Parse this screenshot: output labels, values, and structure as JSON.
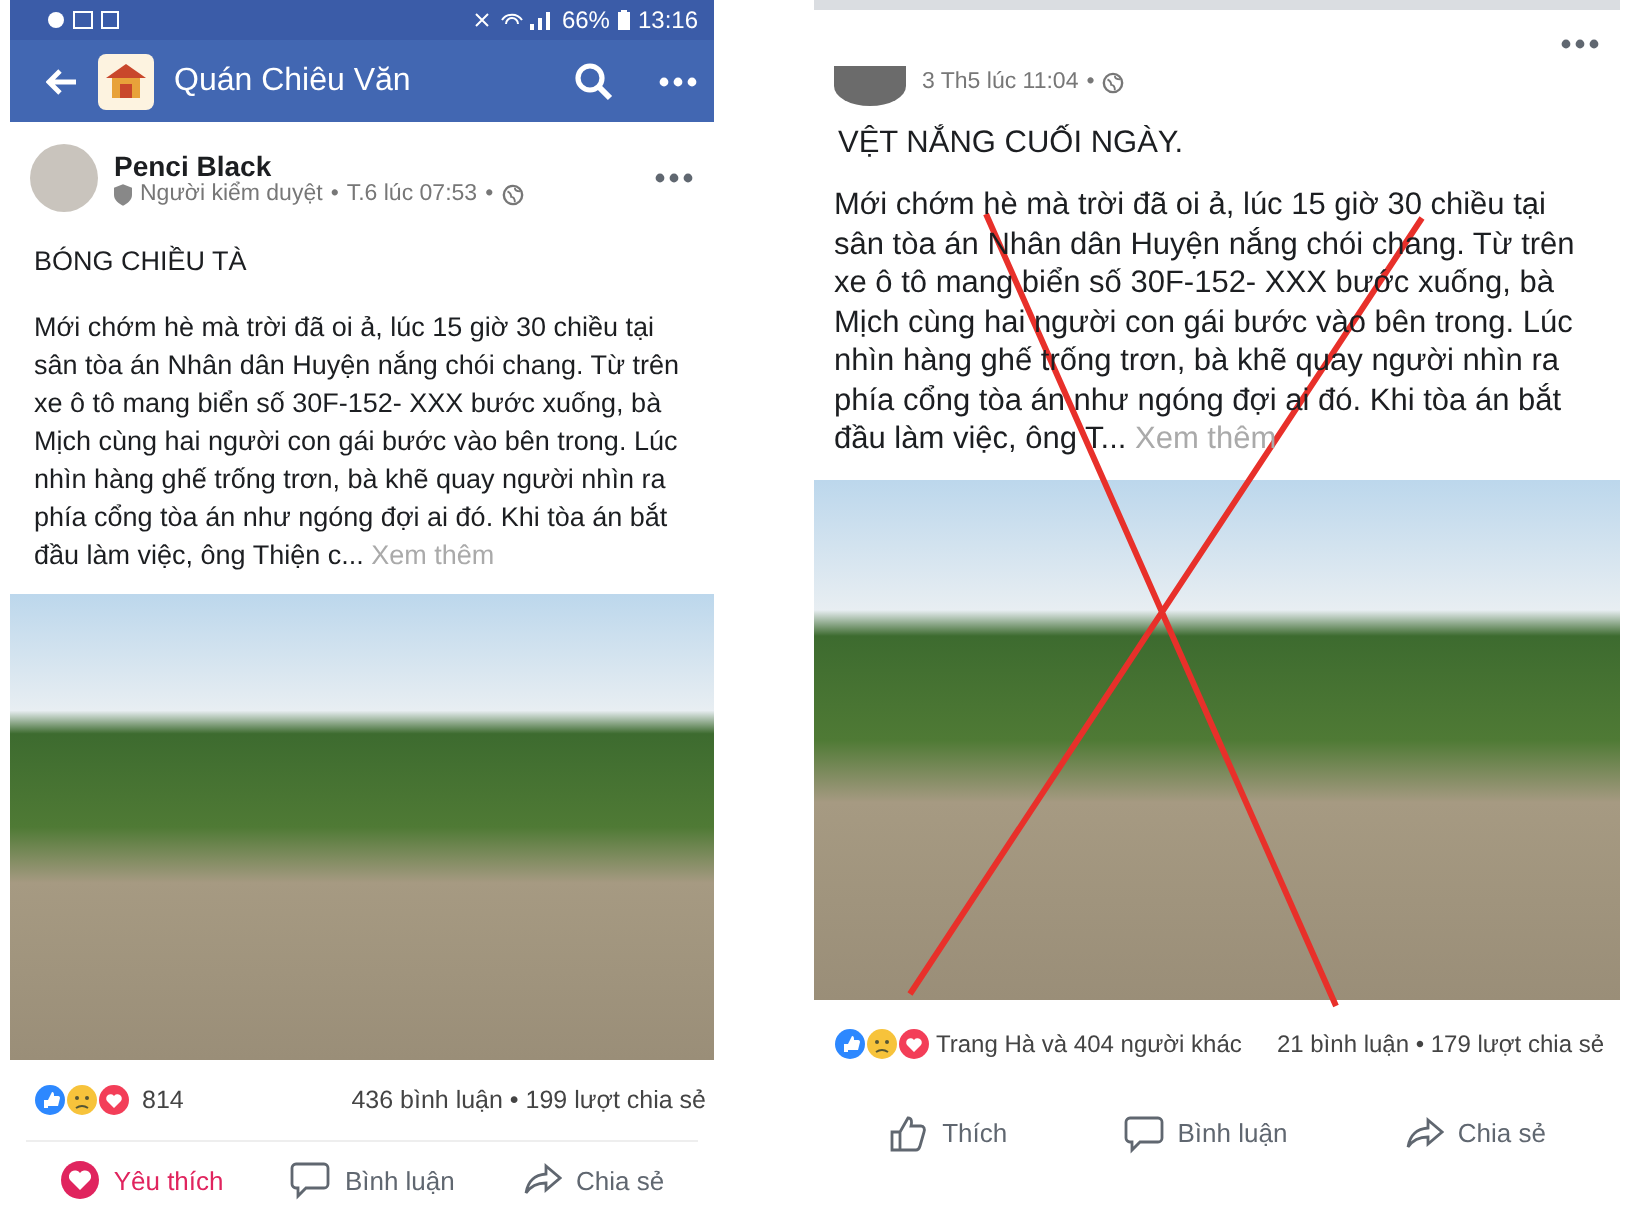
{
  "screens": [
    {
      "separator": "•",
      "status_bar": {
        "battery": "66%",
        "time": "13:16"
      },
      "app_bar": {
        "title": "Quán Chiêu Văn"
      },
      "post": {
        "author": "Penci Black",
        "role": "Người kiểm duyệt",
        "time": "T.6 lúc 07:53",
        "title": "BÓNG CHIỀU TÀ",
        "body": "Mới chớm hè mà trời đã oi ả, lúc 15 giờ 30 chiều tại sân tòa án Nhân dân Huyện nắng chói chang. Từ trên xe ô tô mang biển số 30F-152- XXX bước xuống, bà Mịch cùng hai người con gái bước vào bên trong. Lúc nhìn hàng ghế trống trơn, bà khẽ quay người nhìn ra phía cổng tòa án như ngóng đợi ai đó. Khi tòa án bắt đầu làm việc, ông Thiện c...",
        "see_more": "Xem thêm",
        "crossed_out": false,
        "reactions": "814",
        "stats": "436 bình luận • 199 lượt chia sẻ",
        "actions": [
          {
            "kind": "love",
            "label": "Yêu thích",
            "selected": true
          },
          {
            "kind": "comment",
            "label": "Bình luận",
            "selected": false
          },
          {
            "kind": "share",
            "label": "Chia sẻ",
            "selected": false
          }
        ]
      }
    },
    {
      "separator": "•",
      "post": {
        "time": "3 Th5 lúc 11:04",
        "title": "VỆT NẮNG CUỐI NGÀY.",
        "body": "Mới chớm hè mà trời đã oi ả, lúc 15 giờ 30 chiều tại sân tòa án Nhân dân Huyện nắng chói chang. Từ trên xe ô tô mang biển số 30F-152- XXX bước xuống, bà Mịch cùng hai người con gái bước vào bên trong. Lúc nhìn hàng ghế trống trơn, bà khẽ quay người nhìn ra phía cổng tòa án như ngóng đợi ai đó. Khi tòa án bắt đầu làm việc, ông T...",
        "see_more": "Xem thêm",
        "crossed_out": true,
        "reactions": "Trang Hà và 404 người khác",
        "stats": "21 bình luận • 179 lượt chia sẻ",
        "actions": [
          {
            "kind": "like",
            "label": "Thích",
            "selected": false
          },
          {
            "kind": "comment",
            "label": "Bình luận",
            "selected": false
          },
          {
            "kind": "share",
            "label": "Chia sẻ",
            "selected": false
          }
        ]
      }
    }
  ]
}
